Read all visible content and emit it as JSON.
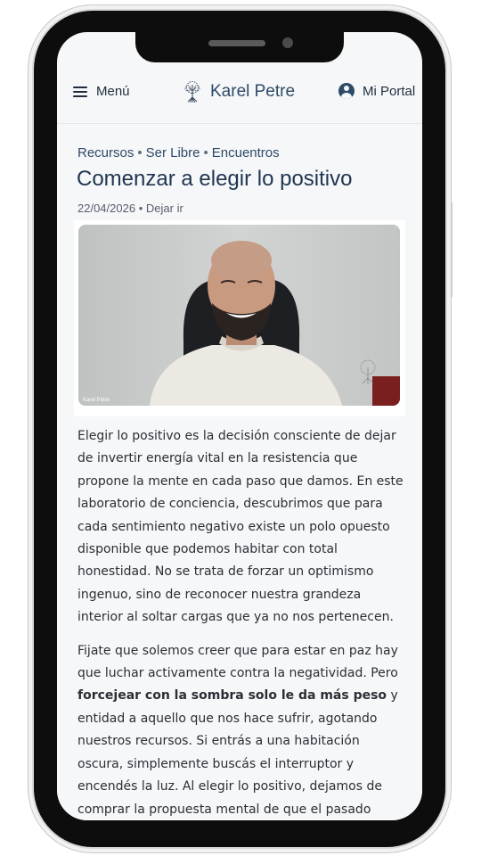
{
  "header": {
    "menu_label": "Menú",
    "brand_name": "Karel Petre",
    "portal_label": "Mi Portal"
  },
  "breadcrumb": [
    "Recursos",
    "Ser Libre",
    "Encuentros"
  ],
  "article": {
    "title": "Comenzar a elegir lo positivo",
    "date": "22/04/2026",
    "tag": "Dejar ir",
    "video_caption": "Karel Petre",
    "paragraph_1": "Elegir lo positivo es la decisión consciente de dejar de invertir energía vital en la resistencia que propone la mente en cada paso que damos. En este laboratorio de conciencia, descubrimos que para cada sentimiento negativo existe un polo opuesto disponible que podemos habitar con total honestidad. No se trata de forzar un optimismo ingenuo, sino de reconocer nuestra grandeza interior al soltar cargas que ya no nos pertenecen.",
    "paragraph_2_start": "Fijate que solemos creer que para estar en paz hay que luchar activamente contra la negatividad. Pero ",
    "paragraph_2_bold": "forcejear con la sombra solo le da más peso",
    "paragraph_2_end": " y entidad a aquello que nos hace sufrir, agotando nuestros recursos. Si entrás a una habitación oscura, simplemente buscás el interruptor y encendés la luz. Al elegir lo positivo, dejamos de comprar la propuesta mental de que el pasado"
  },
  "colors": {
    "brand_blue": "#2e4a66",
    "title_blue": "#1f3550",
    "background": "#f6f7f9"
  },
  "icons": {
    "menu": "hamburger-icon",
    "logo": "tree-logo-icon",
    "portal": "user-circle-icon"
  }
}
